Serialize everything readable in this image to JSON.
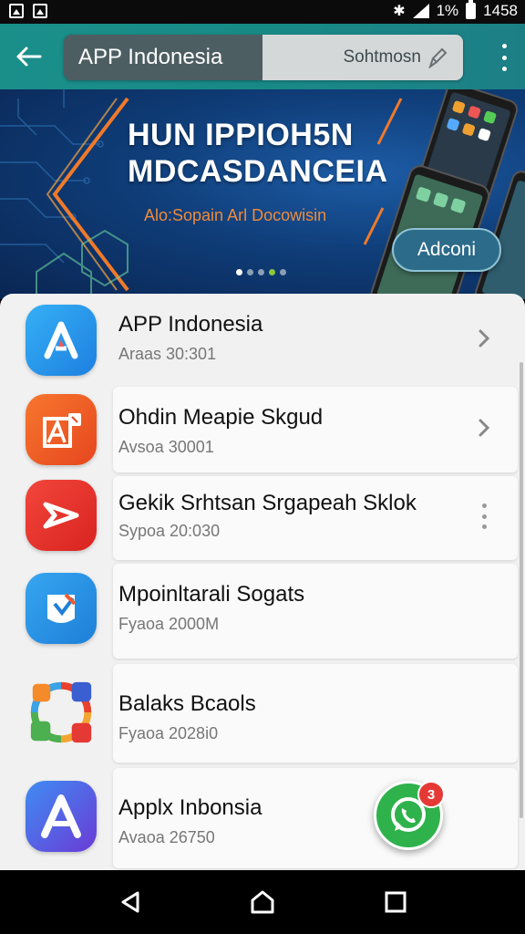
{
  "status_bar": {
    "battery_percent": "1%",
    "time": "1458",
    "icons": [
      "image-icon",
      "image-icon",
      "bluetooth-icon",
      "signal-icon",
      "battery-icon"
    ]
  },
  "app_bar": {
    "search_value": "APP Indonesia",
    "search_placeholder": "Sohtmosn",
    "icons": [
      "back-arrow-icon",
      "mic-icon",
      "more-vert-icon"
    ],
    "color": "#1a8f8a"
  },
  "banner": {
    "title": "HUN IPPIOH5N\nMDCASDANCEIA",
    "subtitle": "Alo:Sopain Arl Docowisin",
    "button_label": "Adconi",
    "page_count": 5,
    "active_page": 1,
    "accent_color": "#f08a3a"
  },
  "apps": [
    {
      "title": "APP Indonesia",
      "subtitle": "Araas 30:301",
      "action": "chevron-right-icon",
      "icon": "letter-a-icon",
      "color": "#2196f3"
    },
    {
      "title": "Ohdin Meapie Skgud",
      "subtitle": "Avsoa 30001",
      "action": "chevron-right-icon",
      "icon": "shop-icon",
      "color": "#f0642a"
    },
    {
      "title": "Gekik Srhtsan Srgapeah Sklok",
      "subtitle": "Sypoa 20:030",
      "action": "more-vert-icon",
      "icon": "arrow-icon",
      "color": "#e8302a"
    },
    {
      "title": "Mpoinltarali Sogats",
      "subtitle": "Fyaoa 2000M",
      "action": "",
      "icon": "flag-icon",
      "color": "#1e88e5"
    },
    {
      "title": "Balaks Bcaols",
      "subtitle": "Fyaoa 2028i0",
      "action": "",
      "icon": "app-cluster-icon",
      "color": "#ff9800"
    },
    {
      "title": "Applx Inbonsia",
      "subtitle": "Avaoa 26750",
      "action": "",
      "icon": "letter-a-icon",
      "color": "#5e35b1"
    }
  ],
  "fab": {
    "icon": "whatsapp-icon",
    "badge": "3",
    "color": "#2fb24c"
  },
  "nav": {
    "icons": [
      "back-icon",
      "home-icon",
      "recents-icon"
    ]
  }
}
